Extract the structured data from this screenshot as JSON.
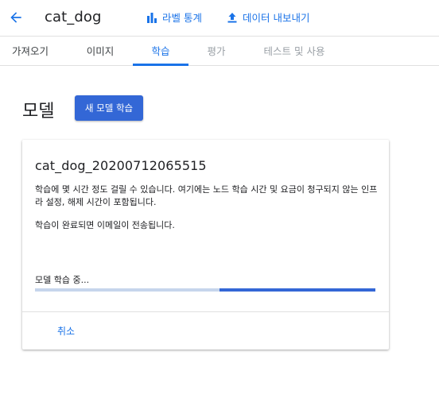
{
  "header": {
    "title": "cat_dog",
    "back_icon": "arrow-back-icon",
    "actions": [
      {
        "label": "라벨 통계",
        "icon": "bar-chart-icon"
      },
      {
        "label": "데이터 내보내기",
        "icon": "upload-icon"
      }
    ]
  },
  "tabs": [
    {
      "label": "가져오기",
      "state": "normal"
    },
    {
      "label": "이미지",
      "state": "normal"
    },
    {
      "label": "학습",
      "state": "active"
    },
    {
      "label": "평가",
      "state": "disabled"
    },
    {
      "label": "테스트 및 사용",
      "state": "disabled"
    }
  ],
  "section": {
    "title": "모델",
    "new_model_button": "새 모델 학습"
  },
  "card": {
    "model_name": "cat_dog_20200712065515",
    "description": "학습에 몇 시간 정도 걸릴 수 있습니다. 여기에는 노드 학습 시간 및 요금이 청구되지 않는 인프라 설정, 해제 시간이 포함됩니다.",
    "email_note": "학습이 완료되면 이메일이 전송됩니다.",
    "progress_label": "모델 학습 중...",
    "progress_indeterminate": true,
    "cancel_button": "취소"
  },
  "colors": {
    "accent": "#1a73e8",
    "button_primary": "#3367d6",
    "progress_track": "#c6d5ec",
    "disabled_text": "#9aa0a6"
  }
}
